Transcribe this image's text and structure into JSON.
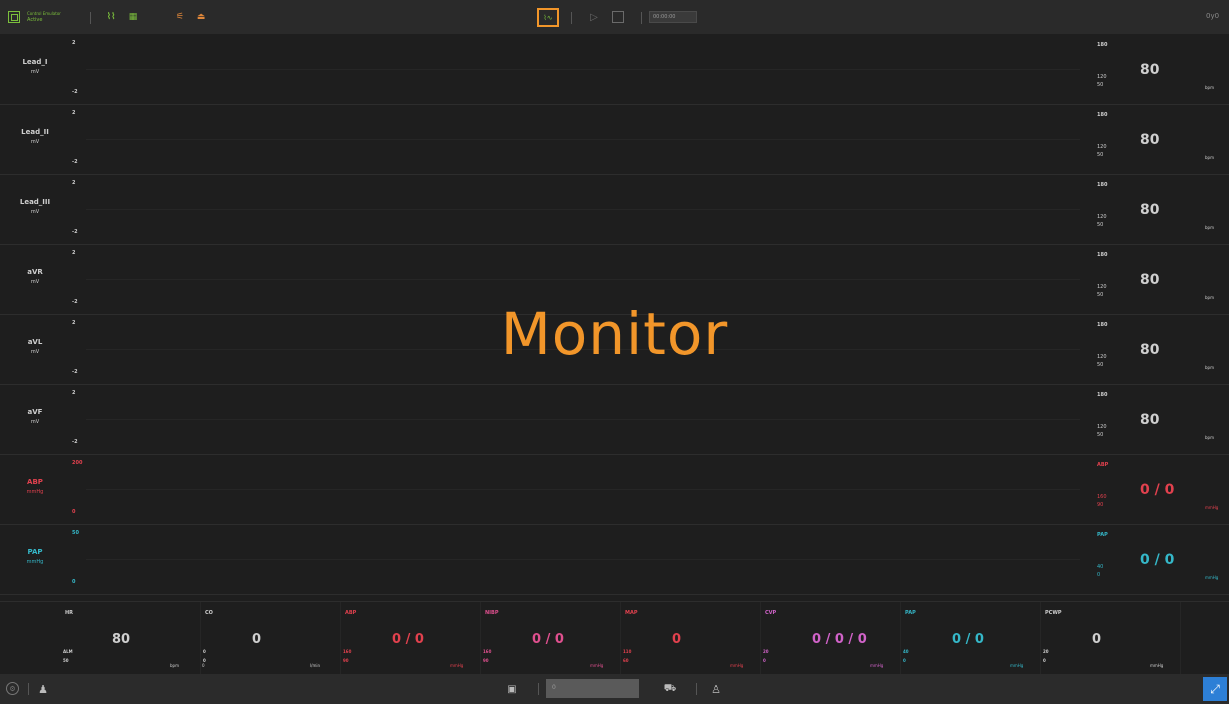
{
  "topbar": {
    "app_status_line1": "Control Emulator",
    "app_status_line2": "Active",
    "time_display": "00:00:00",
    "right_glyph": "0y0"
  },
  "watermark": "Monitor",
  "lanes": [
    {
      "name": "Lead_I",
      "unit": "mV",
      "scale_top": "2",
      "scale_bottom": "-2",
      "color": "#cfcfcf",
      "alarm_high": "180",
      "alarm_mid": "120",
      "alarm_low": "50",
      "value": "80",
      "value_unit": "bpm"
    },
    {
      "name": "Lead_II",
      "unit": "mV",
      "scale_top": "2",
      "scale_bottom": "-2",
      "color": "#cfcfcf",
      "alarm_high": "180",
      "alarm_mid": "120",
      "alarm_low": "50",
      "value": "80",
      "value_unit": "bpm"
    },
    {
      "name": "Lead_III",
      "unit": "mV",
      "scale_top": "2",
      "scale_bottom": "-2",
      "color": "#cfcfcf",
      "alarm_high": "180",
      "alarm_mid": "120",
      "alarm_low": "50",
      "value": "80",
      "value_unit": "bpm"
    },
    {
      "name": "aVR",
      "unit": "mV",
      "scale_top": "2",
      "scale_bottom": "-2",
      "color": "#cfcfcf",
      "alarm_high": "180",
      "alarm_mid": "120",
      "alarm_low": "50",
      "value": "80",
      "value_unit": "bpm"
    },
    {
      "name": "aVL",
      "unit": "mV",
      "scale_top": "2",
      "scale_bottom": "-2",
      "color": "#cfcfcf",
      "alarm_high": "180",
      "alarm_mid": "120",
      "alarm_low": "50",
      "value": "80",
      "value_unit": "bpm"
    },
    {
      "name": "aVF",
      "unit": "mV",
      "scale_top": "2",
      "scale_bottom": "-2",
      "color": "#cfcfcf",
      "alarm_high": "180",
      "alarm_mid": "120",
      "alarm_low": "50",
      "value": "80",
      "value_unit": "bpm"
    },
    {
      "name": "ABP",
      "unit": "mmHg",
      "scale_top": "200",
      "scale_bottom": "0",
      "color": "#e2414e",
      "alarm_high": "ABP",
      "alarm_mid": "160",
      "alarm_low": "90",
      "value": "0 / 0",
      "value_unit": "mmHg"
    },
    {
      "name": "PAP",
      "unit": "mmHg",
      "scale_top": "50",
      "scale_bottom": "0",
      "color": "#35b8c9",
      "alarm_high": "PAP",
      "alarm_mid": "40",
      "alarm_low": "0",
      "value": "0 / 0",
      "value_unit": "mmHg"
    }
  ],
  "bottom_cells": [
    {
      "name": "HR",
      "value": "80",
      "lim_high": "ALM",
      "lim_low": "50",
      "unit": "bpm",
      "unit2": "0",
      "color": "#cfcfcf"
    },
    {
      "name": "CO",
      "value": "0",
      "lim_high": "0",
      "lim_low": "0",
      "unit": "l/min",
      "unit2": "",
      "color": "#cfcfcf"
    },
    {
      "name": "ABP",
      "value": "0 / 0",
      "lim_high": "160",
      "lim_low": "90",
      "unit": "mmHg",
      "unit2": "",
      "color": "#e2414e"
    },
    {
      "name": "NIBP",
      "value": "0 / 0",
      "lim_high": "160",
      "lim_low": "90",
      "unit": "mmHg",
      "unit2": "",
      "color": "#e0508f"
    },
    {
      "name": "MAP",
      "value": "0",
      "lim_high": "110",
      "lim_low": "60",
      "unit": "mmHg",
      "unit2": "",
      "color": "#e2414e"
    },
    {
      "name": "CVP",
      "value": "0 / 0 / 0",
      "lim_high": "20",
      "lim_low": "0",
      "unit": "mmHg",
      "unit2": "",
      "color": "#d163c9"
    },
    {
      "name": "PAP",
      "value": "0 / 0",
      "lim_high": "40",
      "lim_low": "0",
      "unit": "mmHg",
      "unit2": "",
      "color": "#35b8c9"
    },
    {
      "name": "PCWP",
      "value": "0",
      "lim_high": "20",
      "lim_low": "0",
      "unit": "mmHg",
      "unit2": "",
      "color": "#cfcfcf"
    }
  ],
  "statusbar": {
    "search_placeholder": "0"
  },
  "colors": {
    "accent": "#f2962a",
    "green": "#7bbf3c",
    "blue_button": "#2d7fd6"
  }
}
